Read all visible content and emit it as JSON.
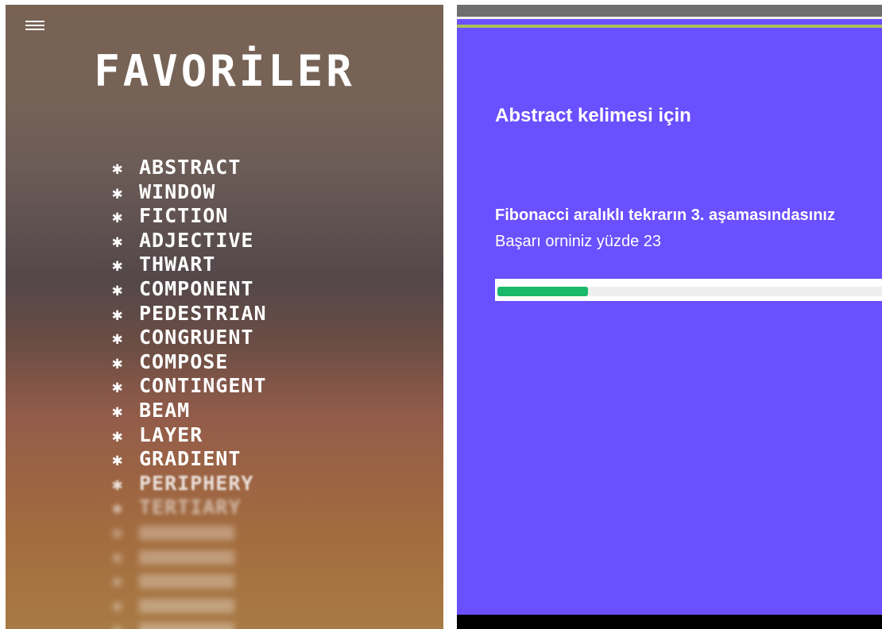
{
  "favorites": {
    "title": "FAVORİLER",
    "bullet": "✱",
    "words": [
      "ABSTRACT",
      "WINDOW",
      "FICTION",
      "ADJECTIVE",
      "THWART",
      "COMPONENT",
      "PEDESTRIAN",
      "CONGRUENT",
      "COMPOSE",
      "CONTINGENT",
      "BEAM",
      "LAYER",
      "GRADIENT",
      "PERIPHERY",
      "TERTIARY"
    ],
    "obscured_word_count": 5
  },
  "study": {
    "title": "Abstract kelimesi için",
    "stage_text": "Fibonacci aralıklı tekrarın 3. aşamasındasınız",
    "success_text": "Başarı orniniz yüzde 23",
    "progress_percent": 23
  },
  "colors": {
    "left_bg_top": "#796253",
    "left_bg_bottom": "#a87a44",
    "right_bg": "#6a50fe",
    "progress_fill": "#1bb86a",
    "top_accent": "#a8c05a"
  },
  "icons": {
    "menu": "hamburger-menu-icon",
    "bullet": "asterisk-icon"
  }
}
